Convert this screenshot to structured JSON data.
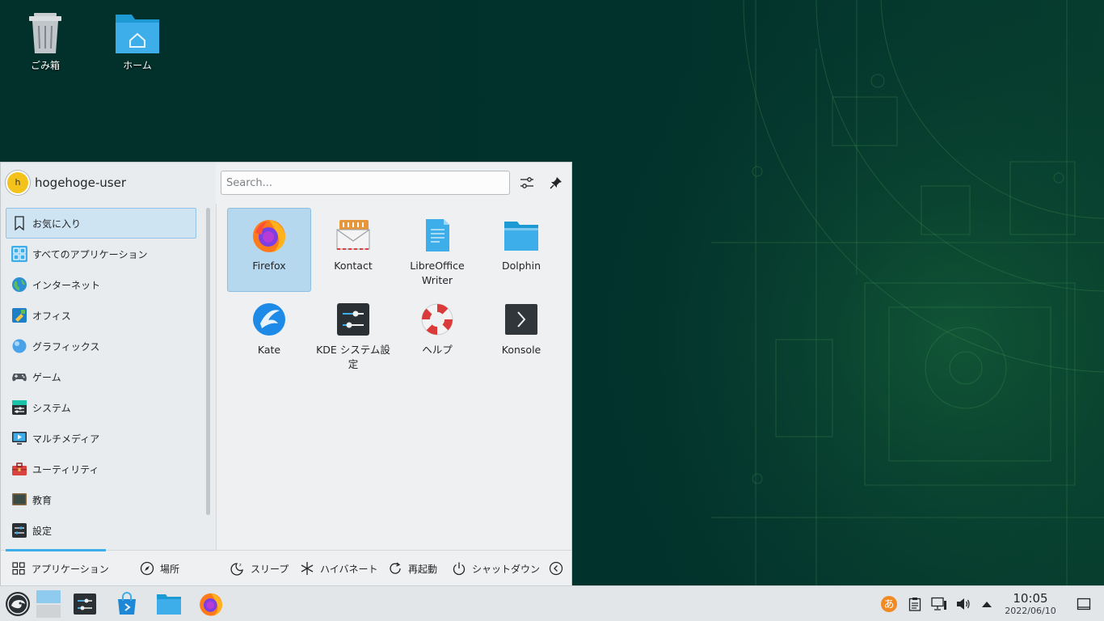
{
  "desktop": {
    "icons": [
      {
        "label": "ごみ箱",
        "icon": "trash-icon"
      },
      {
        "label": "ホーム",
        "icon": "home-folder-icon"
      }
    ]
  },
  "launcher": {
    "username": "hogehoge-user",
    "avatar_letter": "h",
    "search_placeholder": "Search...",
    "categories": [
      {
        "label": "お気に入り",
        "icon": "bookmark-icon",
        "active": true
      },
      {
        "label": "すべてのアプリケーション",
        "icon": "grid-icon"
      },
      {
        "label": "インターネット",
        "icon": "globe-icon"
      },
      {
        "label": "オフィス",
        "icon": "office-icon"
      },
      {
        "label": "グラフィックス",
        "icon": "graphics-icon"
      },
      {
        "label": "ゲーム",
        "icon": "gamepad-icon"
      },
      {
        "label": "システム",
        "icon": "system-icon"
      },
      {
        "label": "マルチメディア",
        "icon": "multimedia-icon"
      },
      {
        "label": "ユーティリティ",
        "icon": "toolbox-icon"
      },
      {
        "label": "教育",
        "icon": "chalkboard-icon"
      },
      {
        "label": "設定",
        "icon": "settings-icon"
      }
    ],
    "apps": [
      {
        "label": "Firefox",
        "icon": "firefox-icon",
        "selected": true
      },
      {
        "label": "Kontact",
        "icon": "kontact-icon"
      },
      {
        "label": "LibreOffice Writer",
        "icon": "writer-icon"
      },
      {
        "label": "Dolphin",
        "icon": "dolphin-folder-icon"
      },
      {
        "label": "Kate",
        "icon": "kate-icon"
      },
      {
        "label": "KDE システム設定",
        "icon": "kde-settings-icon"
      },
      {
        "label": "ヘルプ",
        "icon": "help-lifebuoy-icon"
      },
      {
        "label": "Konsole",
        "icon": "konsole-icon"
      }
    ],
    "footer": {
      "applications": "アプリケーション",
      "places": "場所",
      "sleep": "スリープ",
      "hibernate": "ハイバネート",
      "restart": "再起動",
      "shutdown": "シャットダウン"
    }
  },
  "taskbar": {
    "time": "10:05",
    "date": "2022/06/10",
    "ime_label": "あ"
  },
  "colors": {
    "accent": "#3daee9",
    "selection": "#b5d8ef",
    "desktop_bg": "#02302a"
  }
}
